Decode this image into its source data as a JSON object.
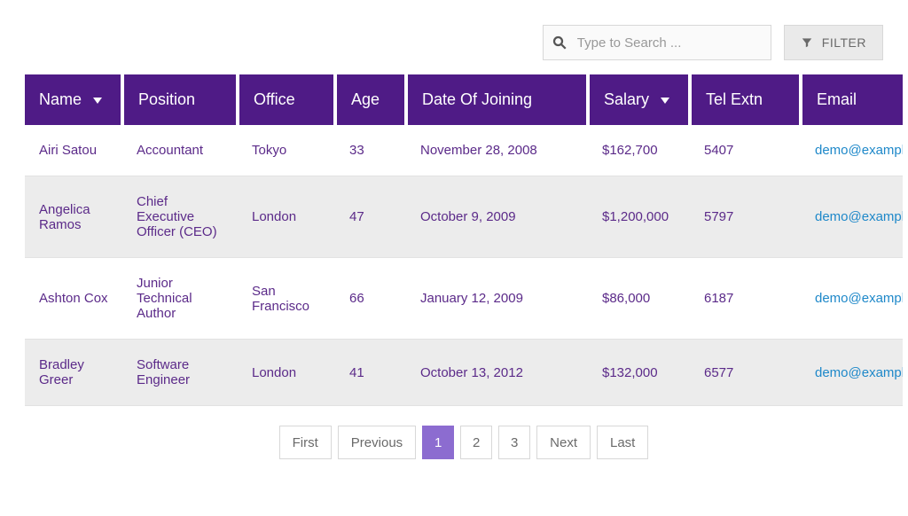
{
  "search": {
    "placeholder": "Type to Search ..."
  },
  "filter_button": "FILTER",
  "columns": {
    "name": {
      "label": "Name",
      "sortable": true
    },
    "position": {
      "label": "Position",
      "sortable": false
    },
    "office": {
      "label": "Office",
      "sortable": false
    },
    "age": {
      "label": "Age",
      "sortable": false
    },
    "doj": {
      "label": "Date Of Joining",
      "sortable": false
    },
    "salary": {
      "label": "Salary",
      "sortable": true
    },
    "ext": {
      "label": "Tel Extn",
      "sortable": false
    },
    "email": {
      "label": "Email",
      "sortable": false
    }
  },
  "rows": [
    {
      "name": "Airi Satou",
      "position": "Accountant",
      "office": "Tokyo",
      "age": "33",
      "doj": "November 28, 2008",
      "salary": "$162,700",
      "ext": "5407",
      "email": "demo@example.com"
    },
    {
      "name": "Angelica Ramos",
      "position": "Chief Executive Officer (CEO)",
      "office": "London",
      "age": "47",
      "doj": "October 9, 2009",
      "salary": "$1,200,000",
      "ext": "5797",
      "email": "demo@example.com"
    },
    {
      "name": "Ashton Cox",
      "position": "Junior Technical Author",
      "office": "San Francisco",
      "age": "66",
      "doj": "January 12, 2009",
      "salary": "$86,000",
      "ext": "6187",
      "email": "demo@example.com"
    },
    {
      "name": "Bradley Greer",
      "position": "Software Engineer",
      "office": "London",
      "age": "41",
      "doj": "October 13, 2012",
      "salary": "$132,000",
      "ext": "6577",
      "email": "demo@example.com"
    }
  ],
  "pagination": {
    "first": "First",
    "previous": "Previous",
    "pages": [
      "1",
      "2",
      "3"
    ],
    "active_page": "1",
    "next": "Next",
    "last": "Last"
  }
}
